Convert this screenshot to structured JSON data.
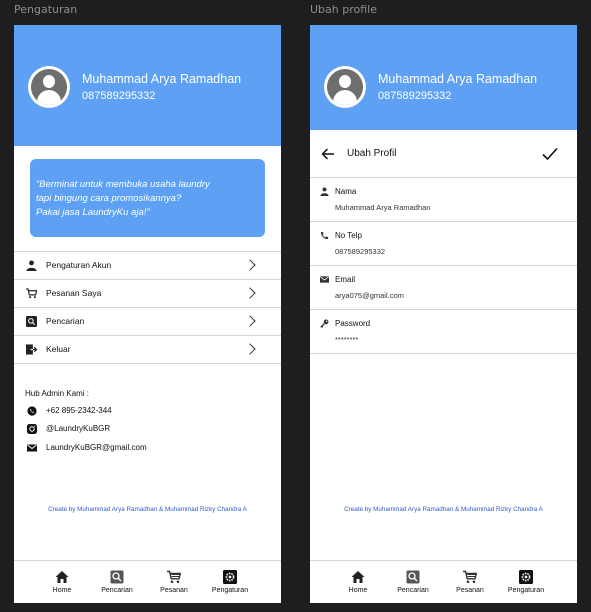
{
  "frames": [
    {
      "label": "Pengaturan"
    },
    {
      "label": "Ubah profile"
    }
  ],
  "profile": {
    "name": "Muhammad Arya Ramadhan",
    "phone": "087589295332"
  },
  "promo": {
    "line1": "“Berminat untuk membuka usaha laundry",
    "line2": "tapi bingung cara promosikannya?",
    "line3": "Pakai jasa LaundryKu aja!”"
  },
  "menu": [
    {
      "label": "Pengaturan Akun",
      "icon": "person-icon"
    },
    {
      "label": "Pesanan Saya",
      "icon": "cart-icon"
    },
    {
      "label": "Pencarian",
      "icon": "search-icon"
    },
    {
      "label": "Keluar",
      "icon": "logout-icon"
    }
  ],
  "contact": {
    "title": "Hub Admin Kami :",
    "items": [
      {
        "text": "+62 895-2342-344",
        "icon": "whatsapp-icon"
      },
      {
        "text": "@LaundryKuBGR",
        "icon": "instagram-icon"
      },
      {
        "text": "LaundryKuBGR@gmail.com",
        "icon": "mail-icon"
      }
    ]
  },
  "credit": "Create by Muhammad Arya Ramadhan & Muhammad Rizky Chandra A",
  "nav": [
    {
      "label": "Home",
      "icon": "home-icon"
    },
    {
      "label": "Pencarian",
      "icon": "search-icon"
    },
    {
      "label": "Pesanan",
      "icon": "cart-icon"
    },
    {
      "label": "Pengaturan",
      "icon": "gear-icon"
    }
  ],
  "edit": {
    "title": "Ubah Profil",
    "fields": [
      {
        "label": "Nama",
        "value": "Muhammad Arya Ramadhan",
        "icon": "person-icon"
      },
      {
        "label": "No Telp",
        "value": "087589295332",
        "icon": "phone-icon"
      },
      {
        "label": "Email",
        "value": "arya075@gmail.com",
        "icon": "mail-icon"
      },
      {
        "label": "Password",
        "value": "********",
        "icon": "key-icon"
      }
    ]
  },
  "colors": {
    "primary": "#5ea1f4",
    "background": "#1e1e1e",
    "credit": "#2d5dc7"
  }
}
